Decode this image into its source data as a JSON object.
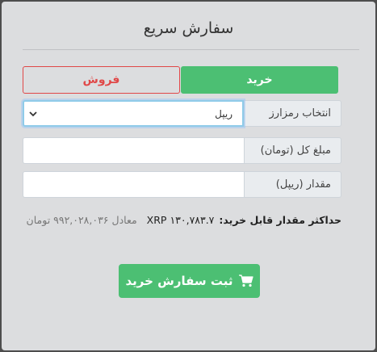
{
  "header": {
    "title": "سفارش سریع"
  },
  "tabs": {
    "buy": "خرید",
    "sell": "فروش"
  },
  "form": {
    "coin_label": "انتخاب رمزارز",
    "coin_value": "ریپل",
    "total_label": "مبلغ کل (تومان)",
    "total_value": "",
    "amount_label": "مقدار (ریپل)",
    "amount_value": ""
  },
  "max_info": {
    "label": "حداکثر مقدار قابل خرید:",
    "amount": "۱۳۰,۷۸۳.۷ XRP",
    "equiv": "معادل ۹۹۲,۰۲۸,۰۳۶ تومان"
  },
  "submit": {
    "label": "ثبت سفارش خرید",
    "icon": "cart-icon"
  },
  "colors": {
    "buy": "#4cbf73",
    "sell": "#e04848",
    "panel": "#dcdddf",
    "backdrop": "#4d4d4d"
  }
}
